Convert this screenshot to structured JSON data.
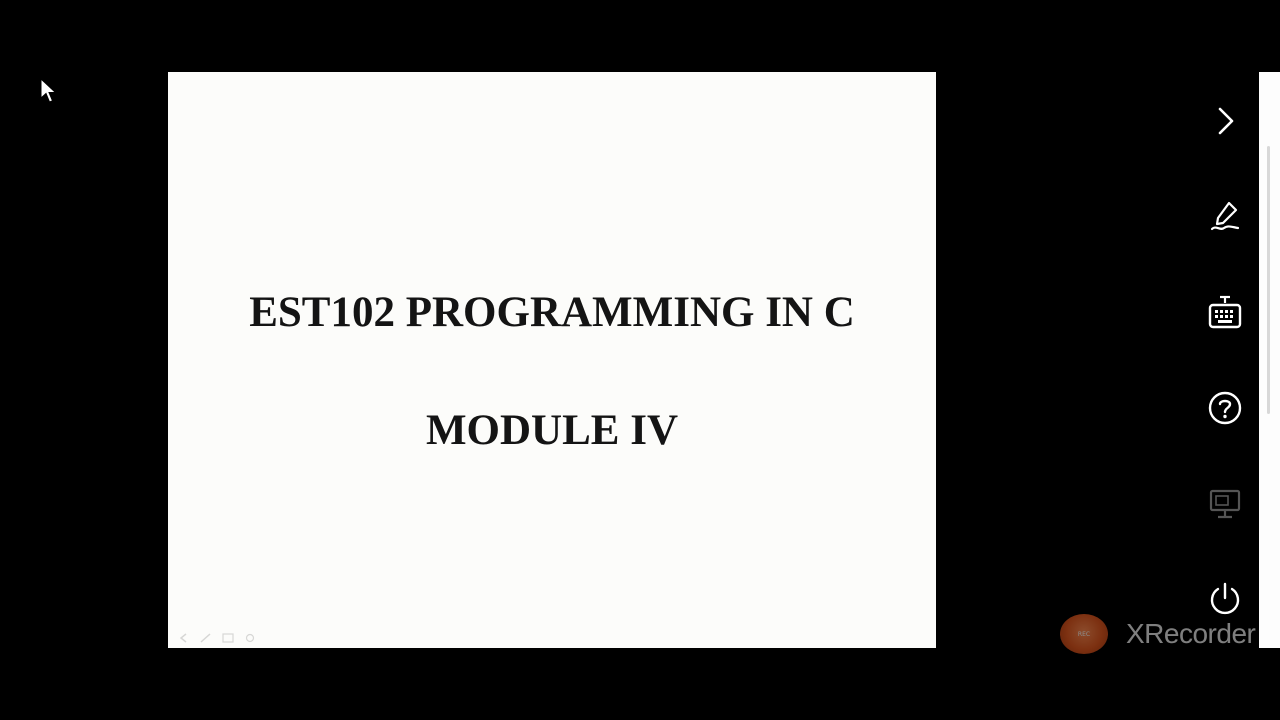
{
  "slide": {
    "title_line1": "EST102 PROGRAMMING IN C",
    "title_line2": "MODULE IV"
  },
  "side_panel": {
    "buttons": [
      {
        "name": "next-slide-button",
        "icon": "chevron-right-icon"
      },
      {
        "name": "annotate-pen-button",
        "icon": "pen-icon"
      },
      {
        "name": "keyboard-button",
        "icon": "keyboard-icon"
      },
      {
        "name": "help-button",
        "icon": "help-circle-icon"
      },
      {
        "name": "display-button",
        "icon": "monitor-icon",
        "state": "disabled"
      },
      {
        "name": "power-button",
        "icon": "power-icon"
      }
    ]
  },
  "watermark": {
    "text": "XRecorder"
  },
  "colors": {
    "background": "#000000",
    "slide_background": "#fcfcfa",
    "slide_text": "#141414",
    "icon": "#ffffff",
    "icon_disabled": "#555555",
    "watermark_accent": "#e2581f"
  }
}
